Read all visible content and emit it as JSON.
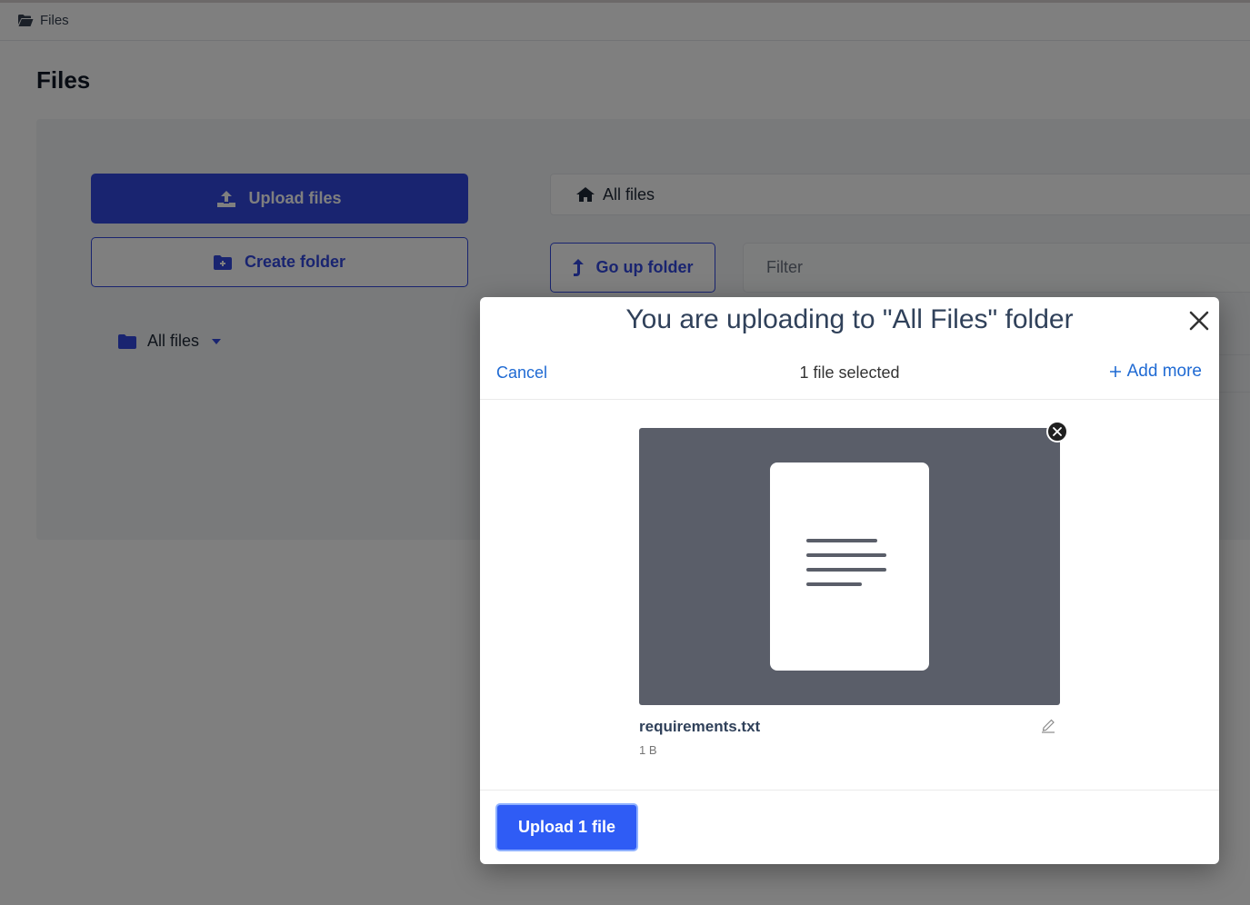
{
  "breadcrumb": {
    "label": "Files"
  },
  "page": {
    "title": "Files"
  },
  "sidebar": {
    "upload_label": "Upload files",
    "create_folder_label": "Create folder",
    "tree_root_label": "All files"
  },
  "browser": {
    "path_label": "All files",
    "go_up_label": "Go up folder",
    "filter_placeholder": "Filter"
  },
  "modal": {
    "title": "You are uploading to \"All Files\" folder",
    "cancel_label": "Cancel",
    "selected_count": "1 file selected",
    "add_more_label": "Add more",
    "files": [
      {
        "name": "requirements.txt",
        "size": "1 B"
      }
    ],
    "upload_label": "Upload 1 file"
  },
  "colors": {
    "primary": "#3349e0",
    "modal_primary": "#2f5cf5",
    "link": "#1f6ad3",
    "preview_bg": "#5a5e69"
  }
}
